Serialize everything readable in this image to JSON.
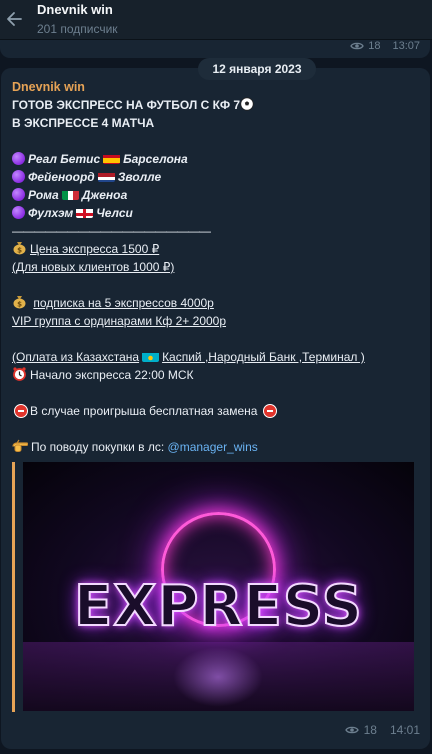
{
  "header": {
    "title": "Dnevnik win",
    "subtitle": "201 подписчик"
  },
  "previous_message": {
    "views": "18",
    "time": "13:07"
  },
  "date_pill": "12 января 2023",
  "message": {
    "author": "Dnevnik win",
    "title_line1": "ГОТОВ  ЭКСПРЕСС НА ФУТБОЛ  С КФ 7",
    "title_line2": "В ЭКСПРЕССЕ 4 МАТЧА",
    "matches": [
      {
        "home": "Реал Бетис",
        "away": "Барселона",
        "flag": "spain"
      },
      {
        "home": "Фейеноорд",
        "away": "Зволле",
        "flag": "netherlands"
      },
      {
        "home": "Рома",
        "away": "Дженоа",
        "flag": "italy"
      },
      {
        "home": "Фулхэм",
        "away": "Челси",
        "flag": "england"
      }
    ],
    "divider": "——————————————————",
    "price_line": "Цена экспресса 1500 ₽",
    "new_clients_line": "(Для новых клиентов 1000 ₽)",
    "subscription_line": "подписка на 5 экспрессов 4000р",
    "vip_line": "VIP группа с ординарами Кф 2+ 2000р",
    "kz_payment_prefix": "(Оплата из Казахстана",
    "kz_payment_suffix": "Каспий ,Народный Банк ,Терминал )",
    "start_line": "Начало экспресса 22:00 МСК",
    "loss_line": "В случае проигрыша бесплатная замена",
    "contact_prefix": "По поводу покупки в лс: ",
    "contact_handle": "@manager_wins",
    "image_text": "EXPRESS",
    "views": "18",
    "time": "14:01"
  },
  "colors": {
    "background": "#0e1621",
    "bubble": "#182533",
    "author": "#e6a356",
    "link": "#6ab3f3",
    "meta": "#6d7f8f"
  }
}
